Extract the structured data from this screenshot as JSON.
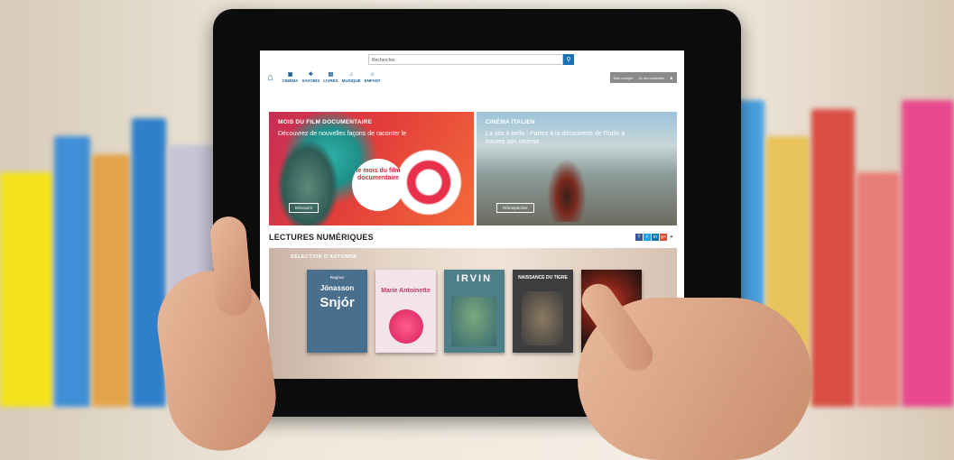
{
  "header": {
    "search_placeholder": "Rechercher",
    "search_icon": "search-icon",
    "home_icon": "home-icon",
    "nav": [
      {
        "label": "Cinéma",
        "icon": "film-icon"
      },
      {
        "label": "Savoirs",
        "icon": "savoirs-icon"
      },
      {
        "label": "Livres",
        "icon": "book-icon"
      },
      {
        "label": "Musique",
        "icon": "music-icon"
      },
      {
        "label": "Enfant",
        "icon": "child-icon"
      }
    ],
    "user_bar": {
      "item1": "Mon compte",
      "item2": "Je me connecte",
      "icon": "user-icon"
    }
  },
  "hero": [
    {
      "title": "Mois du film documentaire",
      "subtitle": "Découvrez de nouvelles façons de raconter le",
      "badge": "le mois du film documentaire",
      "button": "Découvrir"
    },
    {
      "title": "Cinéma italien",
      "subtitle": "La vita è bella ! Partez à la découverte de l'Italie à travers son cinéma",
      "button": "Rétrospective"
    }
  ],
  "lectures": {
    "title": "Lectures numériques",
    "share": [
      "f",
      "t",
      "in",
      "g+",
      "share"
    ],
    "carousel_label": "Sélection d'automne",
    "books": [
      {
        "author": "Ragnar",
        "title_line1": "Jónasson",
        "title_line2": "Snjór",
        "bg": "#4a6f8c"
      },
      {
        "title": "Marie Antoinette",
        "bg": "#f2e4e8"
      },
      {
        "title": "Irvin",
        "bg": "#4d7e8a"
      },
      {
        "title": "Naissance du tigre",
        "bg": "#3d3d3d"
      },
      {
        "title": "",
        "bg": "#2a1510"
      }
    ],
    "next_icon": "chevron-right-icon"
  }
}
